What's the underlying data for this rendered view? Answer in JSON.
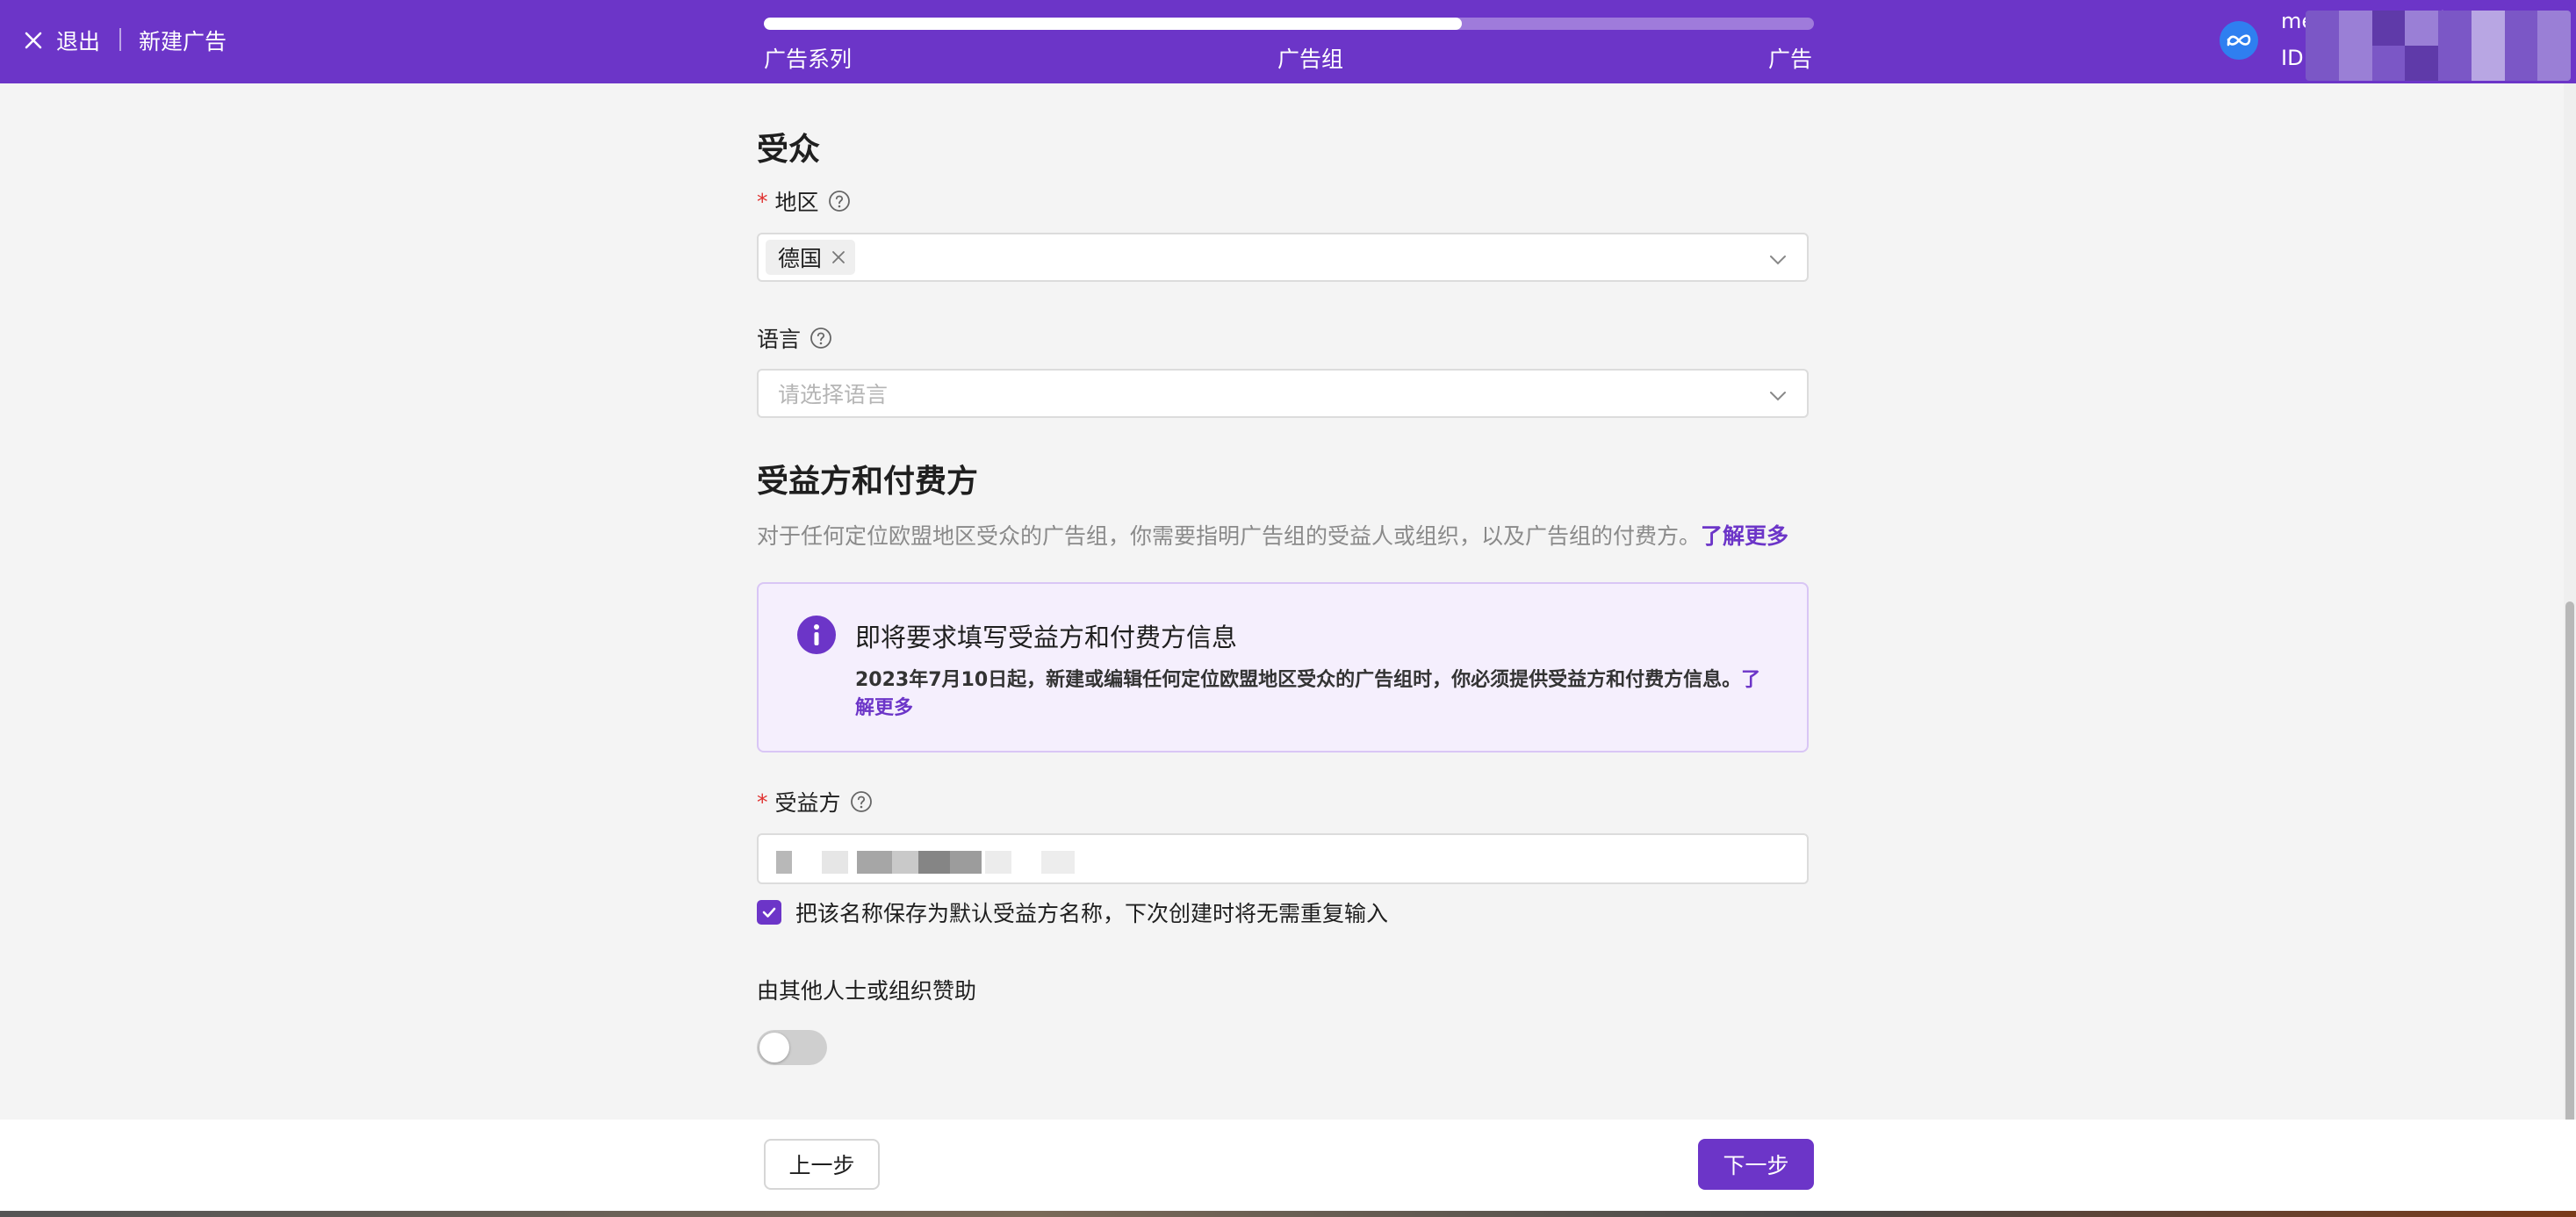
{
  "header": {
    "exit_label": "退出",
    "page_title": "新建广告",
    "progress": 0.665,
    "steps": [
      {
        "label": "广告系列"
      },
      {
        "label": "广告组"
      },
      {
        "label": "广告"
      }
    ],
    "account_name": "meetgames测试dokang_12",
    "account_id_prefix": "ID"
  },
  "audience": {
    "title": "受众",
    "region": {
      "label": "地区",
      "required_mark": "*",
      "selected_tags": [
        "德国"
      ]
    },
    "language": {
      "label": "语言",
      "placeholder": "请选择语言"
    }
  },
  "beneficiary_section": {
    "title": "受益方和付费方",
    "description": "对于任何定位欧盟地区受众的广告组，你需要指明广告组的受益人或组织，以及广告组的付费方。",
    "learn_more": "了解更多",
    "notice": {
      "title": "即将要求填写受益方和付费方信息",
      "text": "2023年7月10日起，新建或编辑任何定位欧盟地区受众的广告组时，你必须提供受益方和付费方信息。",
      "learn_more": "了解更多"
    },
    "beneficiary": {
      "label": "受益方",
      "required_mark": "*"
    },
    "save_default": {
      "label": "把该名称保存为默认受益方名称，下次创建时将无需重复输入",
      "checked": true
    },
    "sponsored": {
      "label": "由其他人士或组织赞助",
      "enabled": false
    }
  },
  "footer": {
    "prev_label": "上一步",
    "next_label": "下一步"
  },
  "colors": {
    "brand": "#6c35c8",
    "required": "#e0312f",
    "notice_bg": "#f5effd"
  }
}
